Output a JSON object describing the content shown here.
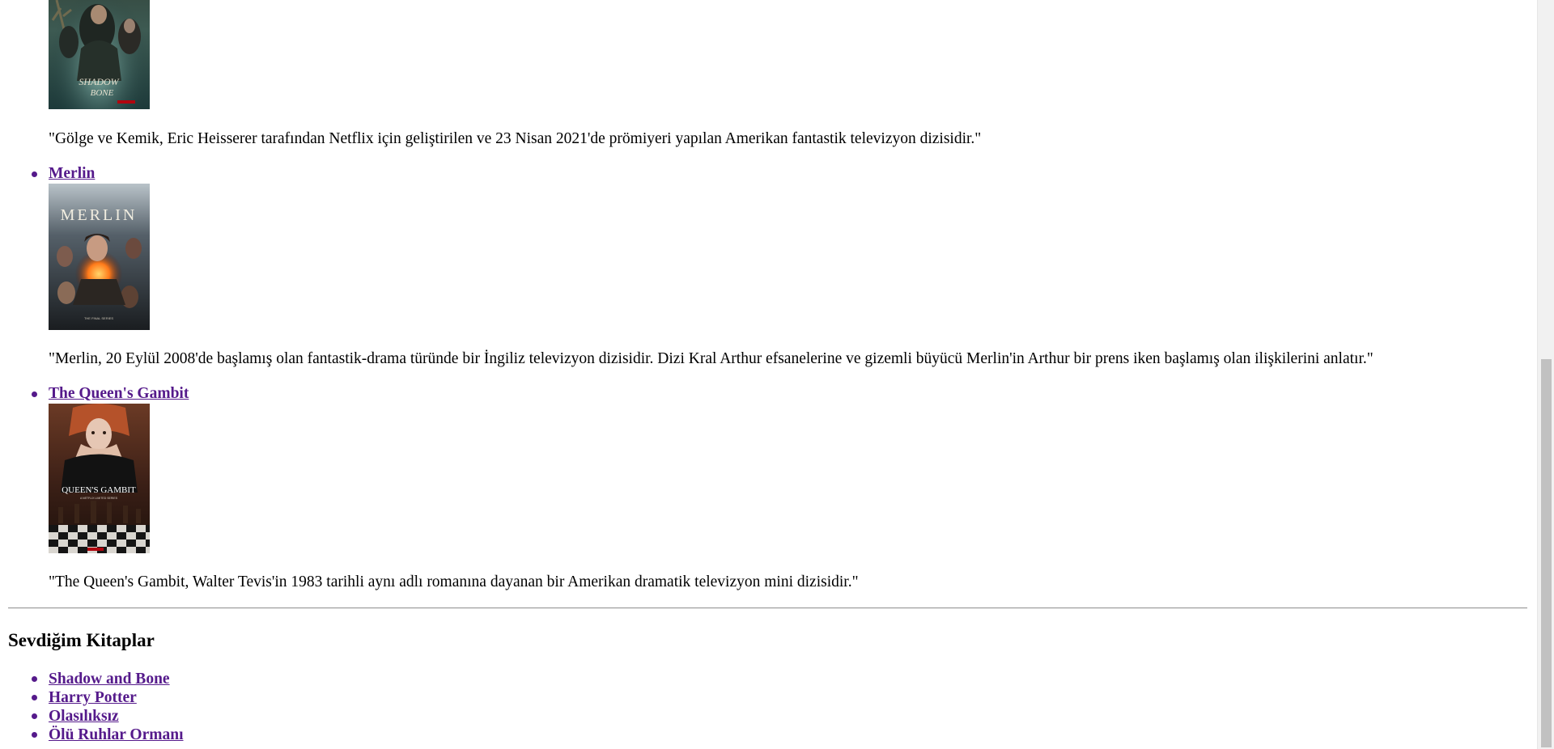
{
  "series": [
    {
      "title": "",
      "poster_icon": "shadow-and-bone-poster",
      "poster_text": "SHADOW AND BONE",
      "description": "\"Gölge ve Kemik, Eric Heisserer tarafından Netflix için geliştirilen ve 23 Nisan 2021'de prömiyeri yapılan Amerikan fantastik televizyon dizisidir.\""
    },
    {
      "title": "Merlin",
      "poster_icon": "merlin-poster",
      "poster_text": "MERLIN",
      "description": "\"Merlin, 20 Eylül 2008'de başlamış olan fantastik-drama türünde bir İngiliz televizyon dizisidir. Dizi Kral Arthur efsanelerine ve gizemli büyücü Merlin'in Arthur bir prens iken başlamış olan ilişkilerini anlatır.\""
    },
    {
      "title": "The Queen's Gambit",
      "poster_icon": "queens-gambit-poster",
      "poster_text": "QUEEN'S GAMBIT",
      "description": "\"The Queen's Gambit, Walter Tevis'in 1983 tarihli aynı adlı romanına dayanan bir Amerikan dramatik televizyon mini dizisidir.\""
    }
  ],
  "books": {
    "heading": "Sevdiğim Kitaplar",
    "items": [
      {
        "label": "Shadow and Bone"
      },
      {
        "label": "Harry Potter"
      },
      {
        "label": "Olasılıksız"
      },
      {
        "label": "Ölü Ruhlar Ormanı"
      }
    ]
  },
  "colors": {
    "link": "#551a8b",
    "text": "#000000",
    "background": "#ffffff",
    "divider": "#9a9a9a",
    "scrollbar_track": "#f1f1f1",
    "scrollbar_thumb": "#c1c1c1"
  }
}
